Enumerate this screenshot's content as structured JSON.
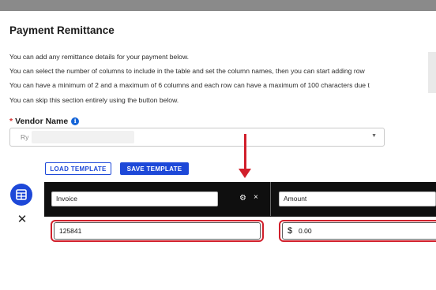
{
  "dialog": {
    "title": "Payment Remittance",
    "info_lines": [
      "You can add any remittance details for your payment below.",
      "You can select the number of columns to include in the table and set the column names, then you can start adding row",
      "You can have a minimum of 2 and a maximum of 6 columns and each row can have a maximum of 100 characters due t",
      "You can skip this section entirely using the button below."
    ]
  },
  "vendor": {
    "required_mark": "*",
    "label": "Vendor Name",
    "info_icon_glyph": "i",
    "selected_value": "Ry",
    "caret_glyph": "▼"
  },
  "template": {
    "load_label": "LOAD TEMPLATE",
    "save_label": "SAVE TEMPLATE"
  },
  "table": {
    "columns": [
      {
        "name": "Invoice"
      },
      {
        "name": "Amount"
      }
    ],
    "gear_glyph": "⚙",
    "close_glyph": "×",
    "rows": [
      {
        "invoice": "125841",
        "currency_symbol": "$",
        "amount": "0.00"
      }
    ],
    "remove_row_glyph": "✕"
  },
  "colors": {
    "accent": "#1d48d8",
    "annotation": "#d11f2b",
    "header_bg": "#0f0f0f"
  }
}
